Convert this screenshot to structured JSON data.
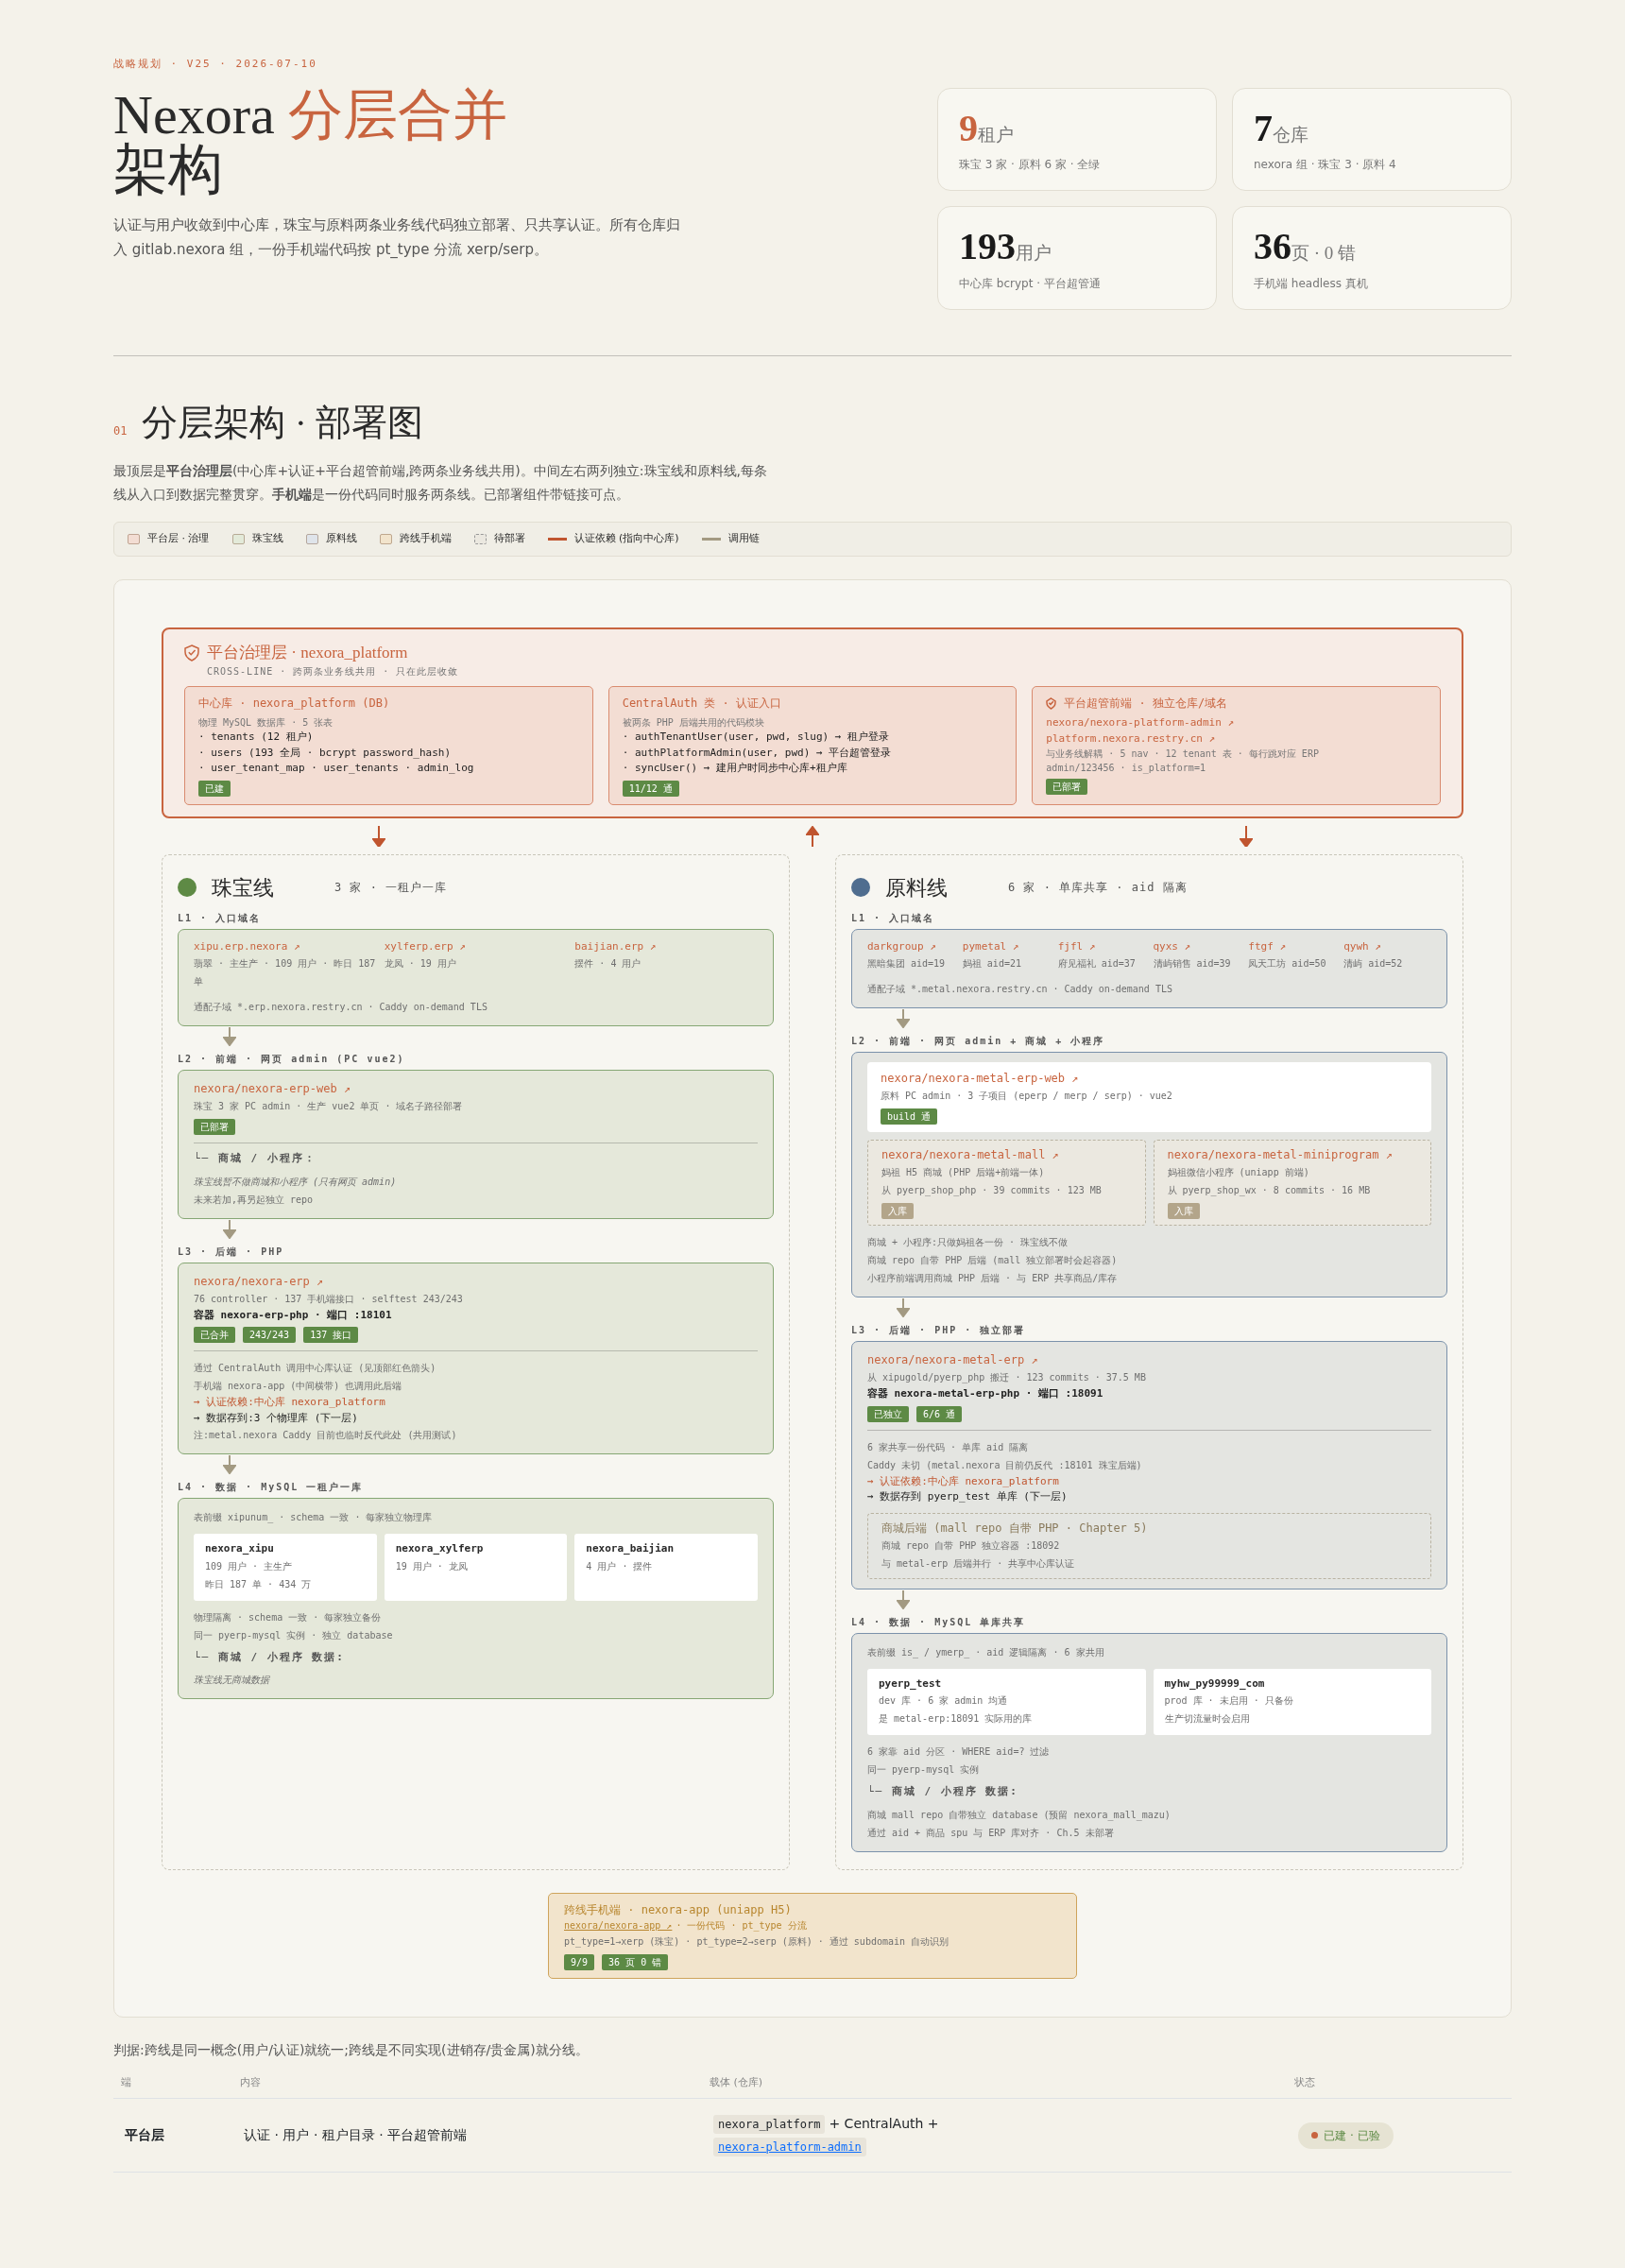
{
  "eyebrow": "战略规划 · V25 · 2026-07-10",
  "title": {
    "main": "Nexora",
    "accent": "分层合并",
    "rest": "架构"
  },
  "intro": "认证与用户收敛到中心库，珠宝与原料两条业务线代码独立部署、只共享认证。所有仓库归入 gitlab.nexora 组，一份手机端代码按 pt_type 分流 xerp/serp。",
  "stats": [
    {
      "value": "9",
      "unit": "租户",
      "note": "珠宝 3 家 · 原料 6 家 · 全绿",
      "highlight": true
    },
    {
      "value": "7",
      "unit": "仓库",
      "note": "nexora 组 · 珠宝 3 · 原料 4",
      "highlight": false
    },
    {
      "value": "193",
      "unit": "用户",
      "note": "中心库 bcrypt · 平台超管通",
      "highlight": false
    },
    {
      "value": "36",
      "unit": "页 · 0 错",
      "note": "手机端 headless 真机",
      "highlight": false
    }
  ],
  "section": {
    "number": "01",
    "title": "分层架构 · 部署图",
    "desc": "最顶层是**平台治理层**(中心库+认证+平台超管前端,跨两条业务线共用)。中间左右两列独立:珠宝线和原料线,每条线从入口到数据完整贯穿。**手机端**是一份代码同时服务两条线。已部署组件带链接可点。"
  },
  "legend": [
    {
      "label": "平台层 · 治理",
      "kind": "swatch",
      "color": "#f3ddd3"
    },
    {
      "label": "珠宝线",
      "kind": "swatch",
      "color": "#e3ead9"
    },
    {
      "label": "原料线",
      "kind": "swatch",
      "color": "#dfe4ea"
    },
    {
      "label": "跨线手机端",
      "kind": "swatch",
      "color": "#f2e4cc"
    },
    {
      "label": "待部署",
      "kind": "dashed",
      "color": "#ebe8e0"
    },
    {
      "label": "认证依赖 (指向中心库)",
      "kind": "line",
      "color": "#c0552f"
    },
    {
      "label": "调用链",
      "kind": "line",
      "color": "#a39a82"
    }
  ],
  "platform": {
    "title": "平台治理层 · nexora_platform",
    "subtitle": "CROSS-LINE · 跨两条业务线共用 · 只在此层收敛",
    "cards": [
      {
        "title": "中心库 · nexora_platform (DB)",
        "notes": [
          "物理 MySQL 数据库 · 5 张表"
        ],
        "items": [
          "· tenants (12 租户)",
          "· users (193 全局 · bcrypt password_hash)",
          "· user_tenant_map · user_tenants · admin_log"
        ],
        "badges": [
          {
            "text": "已建",
            "kind": "done"
          }
        ]
      },
      {
        "title": "CentralAuth 类 · 认证入口",
        "notes": [
          "被两条 PHP 后端共用的代码模块"
        ],
        "items": [
          "· authTenantUser(user, pwd, slug) → 租户登录",
          "· authPlatformAdmin(user, pwd) → 平台超管登录",
          "· syncUser() → 建用户时同步中心库+租户库"
        ],
        "badges": [
          {
            "text": "11/12 通",
            "kind": "done"
          }
        ]
      },
      {
        "title": "平台超管前端 · 独立仓库/域名",
        "links": [
          "nexora/nexora-platform-admin ↗",
          "platform.nexora.restry.cn ↗"
        ],
        "notes": [
          "与业务线解耦 · 5 nav · 12 tenant 表 · 每行跳对应 ERP",
          "admin/123456 · is_platform=1"
        ],
        "badges": [
          {
            "text": "已部署",
            "kind": "done"
          }
        ]
      }
    ]
  },
  "lanes": [
    {
      "name": "珠宝线",
      "color": "#5e8a45",
      "summary": "3 家 · 一租户一库",
      "layers": [
        {
          "label": "L1 · 入口域名",
          "blocks": [
            {
              "kind": "tenants",
              "items": [
                {
                  "domain": "xipu.erp.nexora ↗",
                  "info": "翡翠 · 主生产 · 109 用户 · 昨日 187 单"
                },
                {
                  "domain": "xylferp.erp ↗",
                  "info": "龙凤 · 19 用户"
                },
                {
                  "domain": "baijian.erp ↗",
                  "info": "摆件 · 4 用户"
                }
              ]
            },
            {
              "kind": "note",
              "text": "通配子域 *.erp.nexora.restry.cn · Caddy on-demand TLS"
            }
          ]
        },
        {
          "label": "L2 · 前端 · 网页 admin (PC vue2)",
          "blocks": [
            {
              "kind": "repo",
              "title": "nexora/nexora-erp-web ↗",
              "notes": [
                "珠宝 3 家 PC admin · 生产 vue2 单页 · 域名子路径部署"
              ],
              "badges": [
                {
                  "text": "已部署",
                  "kind": "done"
                }
              ]
            },
            {
              "kind": "divider"
            },
            {
              "kind": "subhead",
              "text": "└─ 商城 / 小程序："
            },
            {
              "kind": "italic",
              "text": "珠宝线暂不做商城和小程序 (只有网页 admin)"
            },
            {
              "kind": "note",
              "text": "未来若加,再另起独立 repo"
            }
          ]
        },
        {
          "label": "L3 · 后端 · PHP",
          "blocks": [
            {
              "kind": "repo",
              "title": "nexora/nexora-erp ↗",
              "notes": [
                "76 controller · 137 手机端接口 · selftest 243/243"
              ],
              "strong": "容器 nexora-erp-php · 端口 :18101",
              "badges": [
                {
                  "text": "已合并",
                  "kind": "done"
                },
                {
                  "text": "243/243",
                  "kind": "done"
                },
                {
                  "text": "137 接口",
                  "kind": "done"
                }
              ]
            },
            {
              "kind": "divider"
            },
            {
              "kind": "note",
              "text": "通过 CentralAuth 调用中心库认证 (见顶部红色箭头)"
            },
            {
              "kind": "note",
              "text": "手机端 nexora-app (中间横带) 也调用此后端"
            },
            {
              "kind": "auth",
              "text": "→ 认证依赖:中心库 nexora_platform"
            },
            {
              "kind": "data",
              "text": "→ 数据存到:3 个物理库 (下一层)"
            },
            {
              "kind": "note",
              "text": "注:metal.nexora Caddy 目前也临时反代此处 (共用测试)"
            }
          ]
        },
        {
          "label": "L4 · 数据 · MySQL 一租户一库",
          "blocks": [
            {
              "kind": "note",
              "text": "表前缀 xipunum_ · schema 一致 · 每家独立物理库"
            },
            {
              "kind": "dbs",
              "items": [
                {
                  "name": "nexora_xipu",
                  "lines": [
                    "109 用户 · 主生产",
                    "昨日 187 单 · 434 万"
                  ]
                },
                {
                  "name": "nexora_xylferp",
                  "lines": [
                    "19 用户 · 龙凤"
                  ]
                },
                {
                  "name": "nexora_baijian",
                  "lines": [
                    "4 用户 · 摆件"
                  ]
                }
              ]
            },
            {
              "kind": "note",
              "text": "物理隔离 · schema 一致 · 每家独立备份"
            },
            {
              "kind": "note",
              "text": "同一 pyerp-mysql 实例 · 独立 database"
            },
            {
              "kind": "subhead",
              "text": "└─ 商城 / 小程序 数据:"
            },
            {
              "kind": "italic",
              "text": "珠宝线无商城数据"
            }
          ]
        }
      ]
    },
    {
      "name": "原料线",
      "color": "#4f6d8f",
      "summary": "6 家 · 单库共享 · aid 隔离",
      "layers": [
        {
          "label": "L1 · 入口域名",
          "blocks": [
            {
              "kind": "tenants",
              "items": [
                {
                  "domain": "darkgroup ↗",
                  "info": "黑暗集团 aid=19"
                },
                {
                  "domain": "pymetal ↗",
                  "info": "妈祖 aid=21"
                },
                {
                  "domain": "fjfl ↗",
                  "info": "府见福礼 aid=37"
                },
                {
                  "domain": "qyxs ↗",
                  "info": "清屿销售 aid=39"
                },
                {
                  "domain": "ftgf ↗",
                  "info": "凤天工坊 aid=50"
                },
                {
                  "domain": "qywh ↗",
                  "info": "清屿 aid=52"
                }
              ]
            },
            {
              "kind": "note",
              "text": "通配子域 *.metal.nexora.restry.cn · Caddy on-demand TLS"
            }
          ]
        },
        {
          "label": "L2 · 前端 · 网页 admin + 商城 + 小程序",
          "blocks": [
            {
              "kind": "repo-white",
              "title": "nexora/nexora-metal-erp-web ↗",
              "notes": [
                "原料 PC admin · 3 子项目 (eperp / merp / serp) · vue2"
              ],
              "badges": [
                {
                  "text": "build 通",
                  "kind": "done"
                }
              ]
            },
            {
              "kind": "pair",
              "repos": [
                {
                  "title": "nexora/nexora-metal-mall ↗",
                  "notes": [
                    "妈祖 H5 商城 (PHP 后端+前端一体)",
                    "从 pyerp_shop_php · 39 commits · 123 MB"
                  ],
                  "badges": [
                    {
                      "text": "入库",
                      "kind": "pending"
                    }
                  ]
                },
                {
                  "title": "nexora/nexora-metal-miniprogram ↗",
                  "notes": [
                    "妈祖微信小程序 (uniapp 前端)",
                    "从 pyerp_shop_wx · 8 commits · 16 MB"
                  ],
                  "badges": [
                    {
                      "text": "入库",
                      "kind": "pending"
                    }
                  ]
                }
              ]
            },
            {
              "kind": "note",
              "text": "商城 + 小程序:只做妈祖各一份 · 珠宝线不做"
            },
            {
              "kind": "note",
              "text": "商城 repo 自带 PHP 后端 (mall 独立部署时会起容器)"
            },
            {
              "kind": "note",
              "text": "小程序前端调用商城 PHP 后端 · 与 ERP 共享商品/库存"
            }
          ]
        },
        {
          "label": "L3 · 后端 · PHP · 独立部署",
          "blocks": [
            {
              "kind": "repo",
              "title": "nexora/nexora-metal-erp ↗",
              "notes": [
                "从 xipugold/pyerp_php 搬迁 · 123 commits · 37.5 MB"
              ],
              "strong": "容器 nexora-metal-erp-php · 端口 :18091",
              "badges": [
                {
                  "text": "已独立",
                  "kind": "done"
                },
                {
                  "text": "6/6 通",
                  "kind": "done"
                }
              ]
            },
            {
              "kind": "divider"
            },
            {
              "kind": "note",
              "text": "6 家共享一份代码 · 单库 aid 隔离"
            },
            {
              "kind": "note",
              "text": "Caddy 未切 (metal.nexora 目前仍反代 :18101 珠宝后端)"
            },
            {
              "kind": "auth",
              "text": "→ 认证依赖:中心库 nexora_platform"
            },
            {
              "kind": "data",
              "text": "→ 数据存到 pyerp_test 单库 (下一层)"
            },
            {
              "kind": "dashed",
              "title": "商城后端 (mall repo 自带 PHP · Chapter 5)",
              "notes": [
                "商城 repo 自带 PHP 独立容器 :18092",
                "与 metal-erp 后端并行 · 共享中心库认证"
              ]
            }
          ]
        },
        {
          "label": "L4 · 数据 · MySQL 单库共享",
          "blocks": [
            {
              "kind": "note",
              "text": "表前缀 is_ / ymerp_ · aid 逻辑隔离 · 6 家共用"
            },
            {
              "kind": "dbs",
              "items": [
                {
                  "name": "pyerp_test",
                  "lines": [
                    "dev 库 · 6 家 admin 均通",
                    "是 metal-erp:18091 实际用的库"
                  ]
                },
                {
                  "name": "myhw_py99999_com",
                  "lines": [
                    "prod 库 · 未启用 · 只备份",
                    "生产切流量时会启用"
                  ]
                }
              ]
            },
            {
              "kind": "note",
              "text": "6 家靠 aid 分区 · WHERE aid=? 过滤"
            },
            {
              "kind": "note",
              "text": "同一 pyerp-mysql 实例"
            },
            {
              "kind": "subhead",
              "text": "└─ 商城 / 小程序 数据:"
            },
            {
              "kind": "note",
              "text": "商城 mall repo 自带独立 database (预留 nexora_mall_mazu)"
            },
            {
              "kind": "note",
              "text": "通过 aid + 商品 spu 与 ERP 库对齐 · Ch.5 未部署"
            }
          ]
        }
      ]
    }
  ],
  "mobile": {
    "title": "跨线手机端 · nexora-app (uniapp H5)",
    "link": "nexora/nexora-app ↗",
    "info": "· 一份代码 · pt_type 分流",
    "detail": "pt_type=1→xerp (珠宝) · pt_type=2→serp (原料) · 通过 subdomain 自动识别",
    "badges": [
      {
        "text": "9/9",
        "kind": "done"
      },
      {
        "text": "36 页 0 错",
        "kind": "done"
      }
    ]
  },
  "verdict": "判据:跨线是同一概念(用户/认证)就统一;跨线是不同实现(进销存/贵金属)就分线。",
  "table": {
    "columns": [
      "端",
      "内容",
      "载体 (仓库)",
      "状态"
    ],
    "rows": [
      {
        "layer": "平台层",
        "content": "认证 · 用户 · 租户目录 · 平台超管前端",
        "carrier": [
          {
            "text": "nexora_platform",
            "kind": "code"
          },
          {
            "text": "+ CentralAuth +",
            "kind": "text"
          },
          {
            "text": "nexora-platform-admin",
            "kind": "link"
          }
        ],
        "status": {
          "text": "已建 · 已验",
          "color": "#c8643f"
        }
      }
    ]
  }
}
